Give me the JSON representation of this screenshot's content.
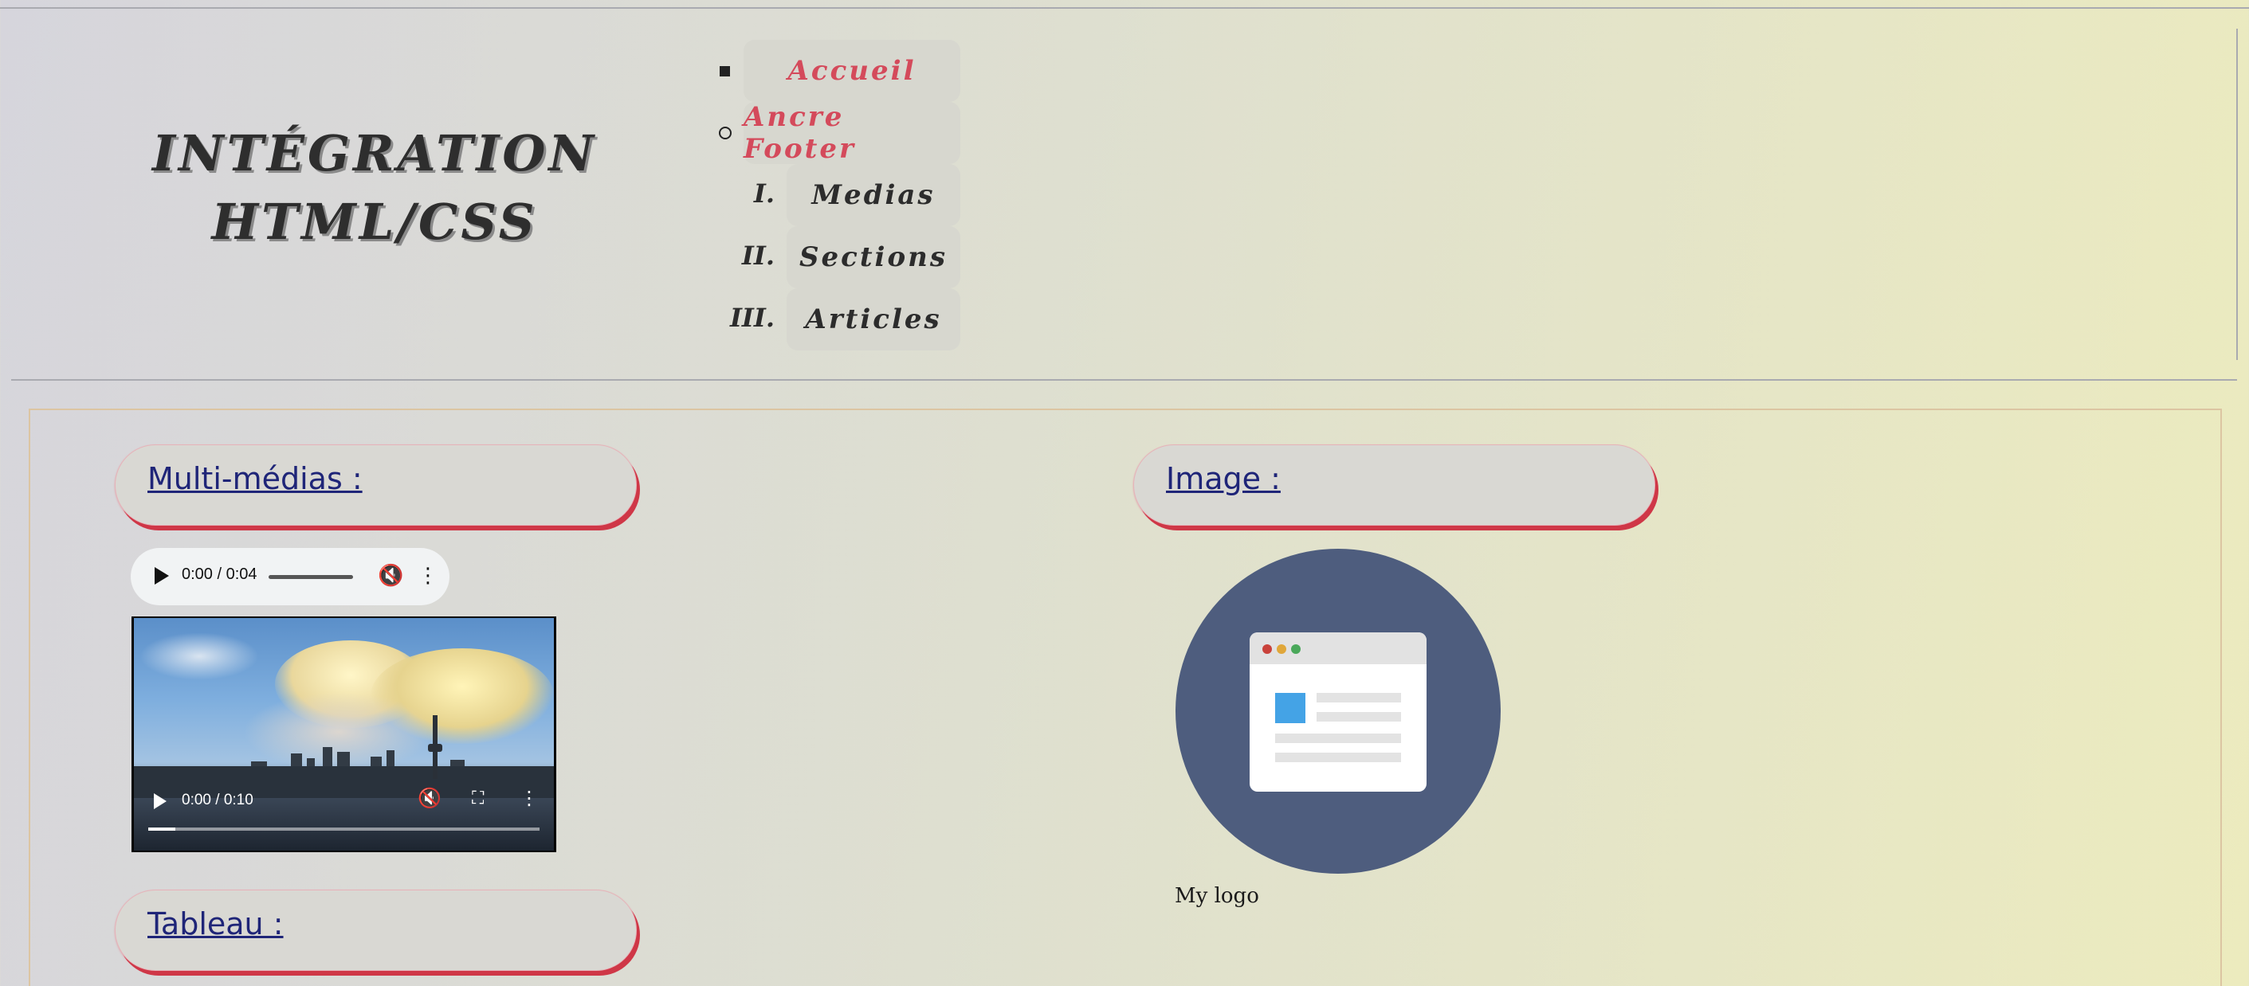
{
  "header": {
    "title_line1": "INTÉGRATION",
    "title_line2": "HTML/CSS"
  },
  "nav": {
    "items": [
      {
        "label": "Accueil",
        "marker": "",
        "bullet": "square",
        "color": "#d44a5b"
      },
      {
        "label": "Ancre Footer",
        "marker": "",
        "bullet": "circle",
        "color": "#d44a5b"
      },
      {
        "label": "Medias",
        "marker": "I.",
        "bullet": "roman",
        "color": "#2c2c2c"
      },
      {
        "label": "Sections",
        "marker": "II.",
        "bullet": "roman",
        "color": "#2c2c2c"
      },
      {
        "label": "Articles",
        "marker": "III.",
        "bullet": "roman",
        "color": "#2c2c2c"
      }
    ]
  },
  "sections": {
    "multimedia": "Multi-médias :",
    "image": "Image :",
    "table": "Tableau :"
  },
  "audio": {
    "time": "0:00 / 0:04",
    "progress": 0,
    "muted": true
  },
  "video": {
    "time": "0:00 / 0:10",
    "progress": 0.07,
    "muted": true
  },
  "logo": {
    "caption": "My logo",
    "circle_color": "#4e5d7e",
    "accent_color": "#44a3e6",
    "dots": [
      "#c9423b",
      "#e0a73a",
      "#4aa85a"
    ]
  },
  "colors": {
    "section_link": "#1f2578",
    "section_shadow": "#cf3747",
    "frame_border": "#dcc5a2"
  }
}
